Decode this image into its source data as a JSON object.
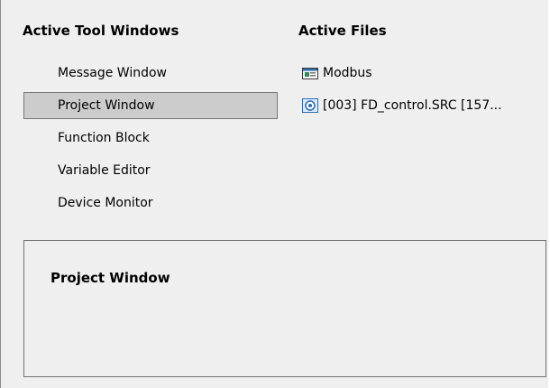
{
  "active_tool_windows": {
    "title": "Active Tool Windows",
    "items": [
      {
        "label": "Message Window",
        "selected": false
      },
      {
        "label": "Project Window",
        "selected": true
      },
      {
        "label": "Function Block",
        "selected": false
      },
      {
        "label": "Variable Editor",
        "selected": false
      },
      {
        "label": "Device Monitor",
        "selected": false
      }
    ]
  },
  "active_files": {
    "title": "Active Files",
    "items": [
      {
        "label": "Modbus",
        "icon": "modbus-file-icon"
      },
      {
        "label": "[003] FD_control.SRC [157...",
        "icon": "source-file-icon"
      }
    ]
  },
  "description": {
    "title": "Project Window"
  },
  "colors": {
    "background": "#efefef",
    "selected_background": "#cccccc",
    "selected_border": "#777777",
    "icon_blue": "#2b6cb0",
    "icon_green": "#2e8b57"
  }
}
